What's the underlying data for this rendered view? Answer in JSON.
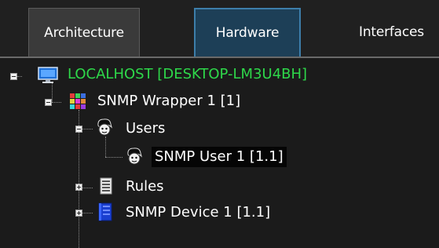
{
  "tabs": [
    {
      "label": "Architecture"
    },
    {
      "label": "Hardware"
    },
    {
      "label": "Interfaces"
    }
  ],
  "tree": {
    "root": {
      "label": "LOCALHOST [DESKTOP-LM3U4BH]",
      "color": "#2ed84a",
      "icon": "computer-monitor-icon"
    },
    "wrapper": {
      "label": "SNMP Wrapper 1 [1]",
      "icon": "rubiks-cube-icon"
    },
    "users": {
      "label": "Users",
      "icon": "user-face-icon"
    },
    "user1": {
      "label": "SNMP User 1 [1.1]",
      "icon": "user-face-icon",
      "selected": true
    },
    "rules": {
      "label": "Rules",
      "icon": "rules-list-icon"
    },
    "device1": {
      "label": "SNMP Device 1 [1.1]",
      "icon": "device-server-icon"
    }
  }
}
